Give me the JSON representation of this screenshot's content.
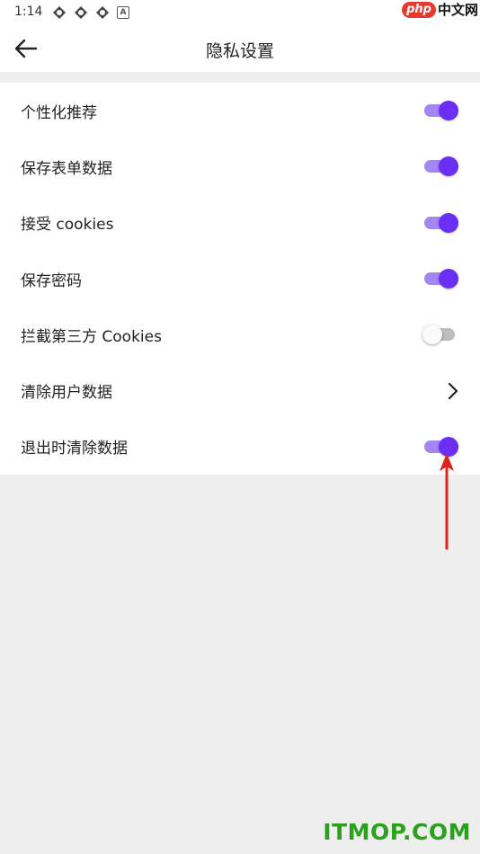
{
  "status_bar": {
    "time": "1:14",
    "icons": [
      "vpn-icon",
      "vpn-icon",
      "vpn-icon",
      "a-icon"
    ],
    "a_label": "A"
  },
  "watermark_top": {
    "badge": "php",
    "text": "中文网"
  },
  "header": {
    "title": "隐私设置"
  },
  "settings": [
    {
      "label": "个性化推荐",
      "type": "switch",
      "checked": true
    },
    {
      "label": "保存表单数据",
      "type": "switch",
      "checked": true
    },
    {
      "label": "接受 cookies",
      "type": "switch",
      "checked": true
    },
    {
      "label": "保存密码",
      "type": "switch",
      "checked": true
    },
    {
      "label": "拦截第三方 Cookies",
      "type": "switch",
      "checked": false
    },
    {
      "label": "清除用户数据",
      "type": "link"
    },
    {
      "label": "退出时清除数据",
      "type": "switch",
      "checked": true
    }
  ],
  "colors": {
    "accent": "#6b2ef5",
    "accent_track": "#a486f3",
    "annotation_arrow": "#e0241b",
    "watermark": "#2aa21e"
  },
  "watermark_bottom": "ITMOP.COM"
}
